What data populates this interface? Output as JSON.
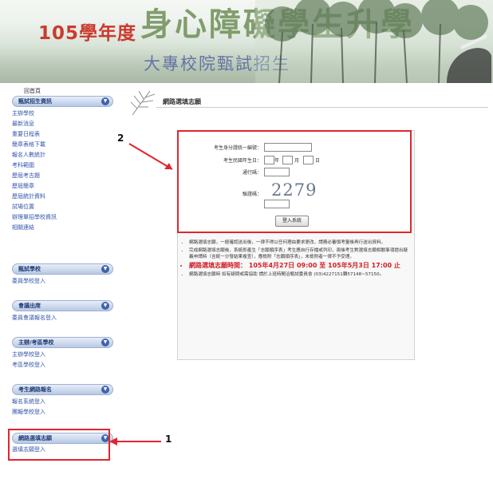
{
  "banner": {
    "year_text": "105學年度",
    "main_title": "身心障礙學生升學",
    "sub_title": "大專校院甄試招生"
  },
  "sidebar": {
    "home": "回首頁",
    "sections": [
      {
        "title": "甄試招生資訊",
        "items": [
          "主辦學校",
          "最新消息",
          "重要日程表",
          "簡章表格下載",
          "報名人數統計",
          "考科範圍",
          "歷屆考古題",
          "歷屆簡章",
          "歷屆統計資料",
          "試場位置",
          "辦理單招學校資訊",
          "相關連結"
        ]
      },
      {
        "title": "甄試學校",
        "items": [
          "委員學校登入"
        ]
      },
      {
        "title": "會議出席",
        "items": [
          "委員會議報名登入"
        ]
      },
      {
        "title": "主辦/考區學校",
        "items": [
          "主辦學校登入",
          "考區學校登入"
        ]
      },
      {
        "title": "考生網路報名",
        "items": [
          "報名系統登入",
          "團報學校登入"
        ]
      },
      {
        "title": "網路選填志願",
        "items": [
          "選填志願登入"
        ]
      }
    ]
  },
  "main": {
    "title": "網路選填志願",
    "form": {
      "id_label": "考生身分證統一編號：",
      "birth_label": "考生民國年生日：",
      "year_unit": "年",
      "month_unit": "月",
      "day_unit": "日",
      "passcode_label": "通行碼：",
      "captcha_label": "驗證碼：",
      "captcha_text": "2279",
      "submit_label": "登入系統"
    },
    "notes": [
      "網路選填志願，一經確認送出後，一律不得以任何理由要求更改，請務必審慎考量後再行送出資料。",
      "完成網路選填志願後，系統即產生「志願順序表」考生應自行存檔或列印，兩後考生對選填志願相關事項提出疑義申請時（含統一分發結果複查），應檢附「志願順序表」，未檢附者一律不予受理。",
      "網路選填志願時間： 105年4月27日 09:00 至 105年5月3日 17:00 止",
      "網路選填志願時 如有疑問或需協助 請於上班時間洽甄試委員會 (03)4227151轉57148~57150。"
    ],
    "note2_highlight": "「志願順序表」"
  },
  "annotations": {
    "marker1": "1",
    "marker2": "2",
    "color": "#e0262c"
  }
}
